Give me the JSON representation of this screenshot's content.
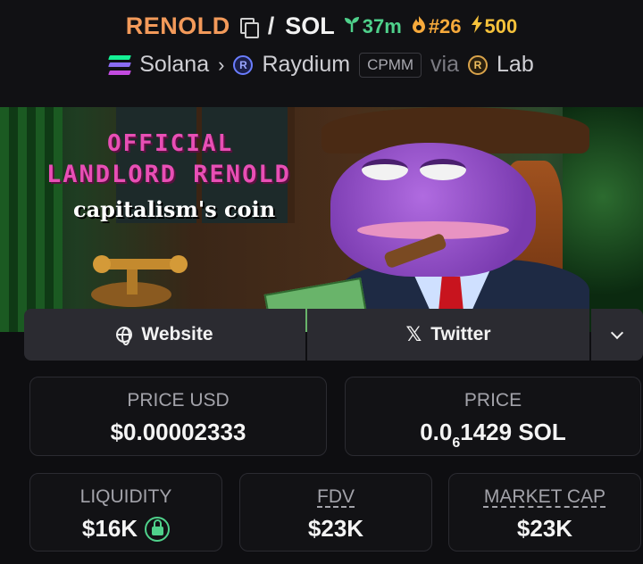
{
  "header": {
    "token_symbol": "RENOLD",
    "separator": "/",
    "quote_symbol": "SOL",
    "age": "37m",
    "trending_rank": "#26",
    "boosts": "500",
    "chain": "Solana",
    "dex": "Raydium",
    "pool_type": "CPMM",
    "via_label": "via",
    "launchpad": "Lab",
    "icons": [
      "copy-icon",
      "seedling-icon",
      "flame-icon",
      "lightning-icon",
      "solana-icon",
      "raydium-icon",
      "lab-icon"
    ],
    "colors": {
      "token": "#f39a5a",
      "age": "#4fd18b",
      "rank": "#f6a93b",
      "boost": "#f6c23b"
    }
  },
  "banner": {
    "line1": "OFFICIAL",
    "line2": "LANDLORD RENOLD",
    "line3": "capitalism's coin"
  },
  "links": {
    "website": "Website",
    "twitter": "Twitter"
  },
  "stats": {
    "price_usd_label": "PRICE USD",
    "price_usd_value": "$0.00002333",
    "price_label": "PRICE",
    "price_prefix": "0.0",
    "price_zeros": "6",
    "price_digits": "1429 SOL",
    "liquidity_label": "LIQUIDITY",
    "liquidity_value": "$16K",
    "fdv_label": "FDV",
    "fdv_value": "$23K",
    "mcap_label": "MARKET CAP",
    "mcap_value": "$23K"
  }
}
